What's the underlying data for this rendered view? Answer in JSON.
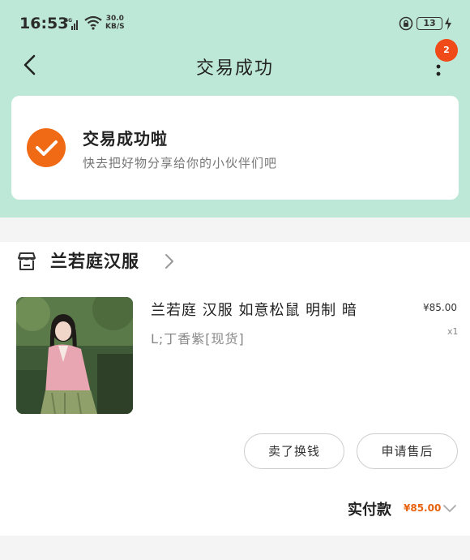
{
  "status_bar": {
    "time": "16:53",
    "signal": "4G",
    "net_speed_value": "30.0",
    "net_speed_unit": "KB/S",
    "battery": "13"
  },
  "nav": {
    "title": "交易成功",
    "badge_count": "2"
  },
  "success": {
    "title": "交易成功啦",
    "subtitle": "快去把好物分享给你的小伙伴们吧"
  },
  "order": {
    "shop_name": "兰若庭汉服",
    "product_name": "兰若庭 汉服 如意松鼠 明制 暗",
    "price": "¥85.00",
    "variant": "L;丁香紫[现货]",
    "quantity": "x1",
    "actions": [
      "卖了换钱",
      "申请售后"
    ],
    "paid_label": "实付款",
    "paid_amount": "¥85.00"
  },
  "colors": {
    "header_bg": "#bde8d8",
    "accent_orange": "#f06a16",
    "badge_red": "#f04a18"
  }
}
